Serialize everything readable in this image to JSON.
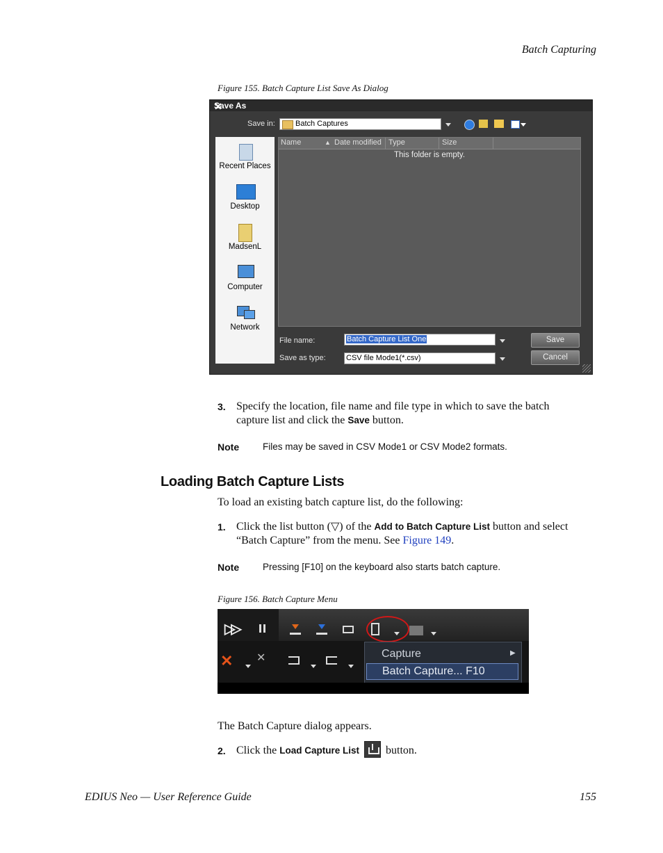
{
  "header": {
    "running_head": "Batch Capturing"
  },
  "figure155": {
    "caption": "Figure 155.  Batch Capture List Save As Dialog",
    "dialog": {
      "title": "Save As",
      "close": "✕",
      "save_in_label": "Save in:",
      "save_in_value": "Batch Captures",
      "places": [
        "Recent Places",
        "Desktop",
        "MadsenL",
        "Computer",
        "Network"
      ],
      "columns": [
        "Name",
        "Date modified",
        "Type",
        "Size"
      ],
      "empty_text": "This folder is empty.",
      "file_name_label": "File name:",
      "file_name_value": "Batch Capture List One",
      "save_as_type_label": "Save as type:",
      "save_as_type_value": "CSV file Mode1(*.csv)",
      "save_button": "Save",
      "cancel_button": "Cancel"
    }
  },
  "step3": {
    "num": "3.",
    "text_a": "Specify the location, file name and file type in which to save the batch",
    "text_b": "capture list and click the ",
    "bold": "Save",
    "text_c": " button."
  },
  "note1": {
    "label": "Note",
    "text": "Files may be saved in CSV Mode1 or CSV Mode2 formats."
  },
  "section": {
    "heading": "Loading Batch Capture Lists",
    "intro": "To load an existing batch capture list, do the following:"
  },
  "step1": {
    "num": "1.",
    "text_a": "Click the list button (▽) of the ",
    "bold": "Add to Batch Capture List",
    "text_b": " button and select",
    "text_c": "“Batch Capture” from the menu. See ",
    "link": "Figure 149",
    "text_d": "."
  },
  "note2": {
    "label": "Note",
    "text": "Pressing [F10] on the keyboard also starts batch capture."
  },
  "figure156": {
    "caption": "Figure 156.  Batch Capture Menu",
    "menu_items": [
      "Capture",
      "Batch Capture...  F10"
    ]
  },
  "after": "The Batch Capture dialog appears.",
  "step2": {
    "num": "2.",
    "text_a": "Click the ",
    "bold": "Load Capture List",
    "text_b": " button."
  },
  "footer": {
    "left": "EDIUS Neo  —  User Reference Guide",
    "page": "155"
  }
}
